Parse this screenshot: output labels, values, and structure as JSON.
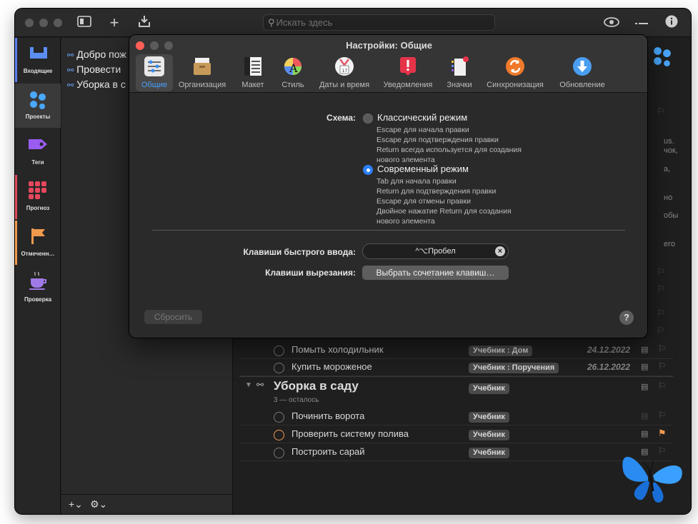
{
  "search": {
    "placeholder": "Искать здесь"
  },
  "sidebar": {
    "items": [
      {
        "label": "Входящие"
      },
      {
        "label": "Проекты"
      },
      {
        "label": "Теги"
      },
      {
        "label": "Прогноз"
      },
      {
        "label": "Отмеченн…"
      },
      {
        "label": "Проверка"
      }
    ]
  },
  "projects": {
    "items": [
      {
        "label": "Добро пож"
      },
      {
        "label": "Провести"
      },
      {
        "label": "Уборка в с"
      }
    ]
  },
  "outline": {
    "partial_text": [
      "us.",
      "чок,",
      "а,",
      "но",
      "обы",
      "его"
    ],
    "rows_top": [
      {
        "title": "Помыть холодильник",
        "context": "Учебник : Дом",
        "date": "24.12.2022"
      },
      {
        "title": "Купить мороженое",
        "context": "Учебник : Поручения",
        "date": "26.12.2022"
      }
    ],
    "group": {
      "title": "Уборка в саду",
      "subtitle": "3 — осталось",
      "context": "Учебник"
    },
    "rows_group": [
      {
        "title": "Починить ворота",
        "context": "Учебник"
      },
      {
        "title": "Проверить систему полива",
        "context": "Учебник"
      },
      {
        "title": "Построить сарай",
        "context": "Учебник"
      }
    ]
  },
  "dialog": {
    "title": "Настройки: Общие",
    "tabs": [
      {
        "label": "Общие",
        "icon": "sliders-icon"
      },
      {
        "label": "Организация",
        "icon": "archive-box-icon"
      },
      {
        "label": "Макет",
        "icon": "layout-icon"
      },
      {
        "label": "Стиль",
        "icon": "color-wheel-icon"
      },
      {
        "label": "Даты и время",
        "icon": "calendar-icon"
      },
      {
        "label": "Уведомления",
        "icon": "alert-icon"
      },
      {
        "label": "Значки",
        "icon": "badges-icon"
      },
      {
        "label": "Синхронизация",
        "icon": "sync-icon"
      },
      {
        "label": "Обновление",
        "icon": "update-icon"
      }
    ],
    "scheme": {
      "label": "Схема:",
      "options": [
        {
          "label": "Классический режим",
          "selected": false,
          "desc": [
            "Escape для начала правки",
            "Escape для подтверждения правки",
            "Return всегда используется для создания",
            "нового элемента"
          ]
        },
        {
          "label": "Современный режим",
          "selected": true,
          "desc": [
            "Tab для начала правки",
            "Return для подтверждения правки",
            "Escape для отмены правки",
            "Двойное нажатие Return для создания",
            "нового элемента"
          ]
        }
      ]
    },
    "quick_entry": {
      "label": "Клавиши быстрого ввода:",
      "value": "^⌥Пробел"
    },
    "clipping": {
      "label": "Клавиши вырезания:",
      "button": "Выбрать сочетание клавиш…"
    },
    "reset_label": "Сбросить",
    "help_label": "?"
  },
  "colors": {
    "accent": "#2c7ff7",
    "flag": "#f09a4e"
  }
}
